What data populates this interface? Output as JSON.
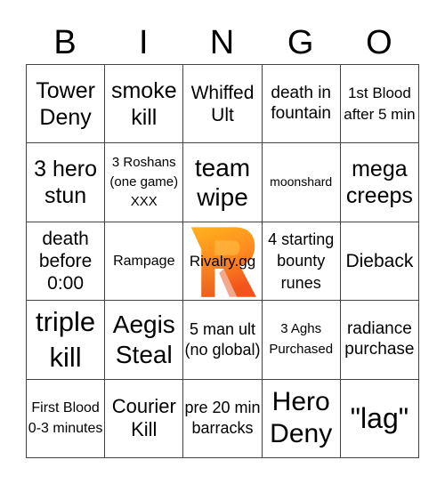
{
  "header": {
    "letters": [
      "B",
      "I",
      "N",
      "G",
      "O"
    ]
  },
  "board": {
    "rows": [
      [
        "Tower Deny",
        "smoke kill",
        "Whiffed Ult",
        "death in fountain",
        "1st Blood after 5 min"
      ],
      [
        "3 hero stun",
        "3 Roshans (one game) XXX",
        "team wipe",
        "moonshard",
        "mega creeps"
      ],
      [
        "death before 0:00",
        "Rampage",
        "Rivalry.gg",
        "4 starting bounty runes",
        "Dieback"
      ],
      [
        "triple kill",
        "Aegis Steal",
        "5 man ult (no global)",
        "3 Aghs Purchased",
        "radiance purchase"
      ],
      [
        "First Blood 0-3 minutes",
        "Courier Kill",
        "pre 20 min barracks",
        "Hero Deny",
        "\"lag\""
      ]
    ],
    "free_space": {
      "label": "Rivalry.gg",
      "icon": "rivalry-r-logo",
      "colors": {
        "gradient_top": "#FFB21E",
        "gradient_bottom": "#F2541B",
        "shadow": "#E8621E"
      }
    }
  },
  "colors": {
    "grid_line": "#444444",
    "text": "#000000",
    "background": "#FFFFFF"
  }
}
